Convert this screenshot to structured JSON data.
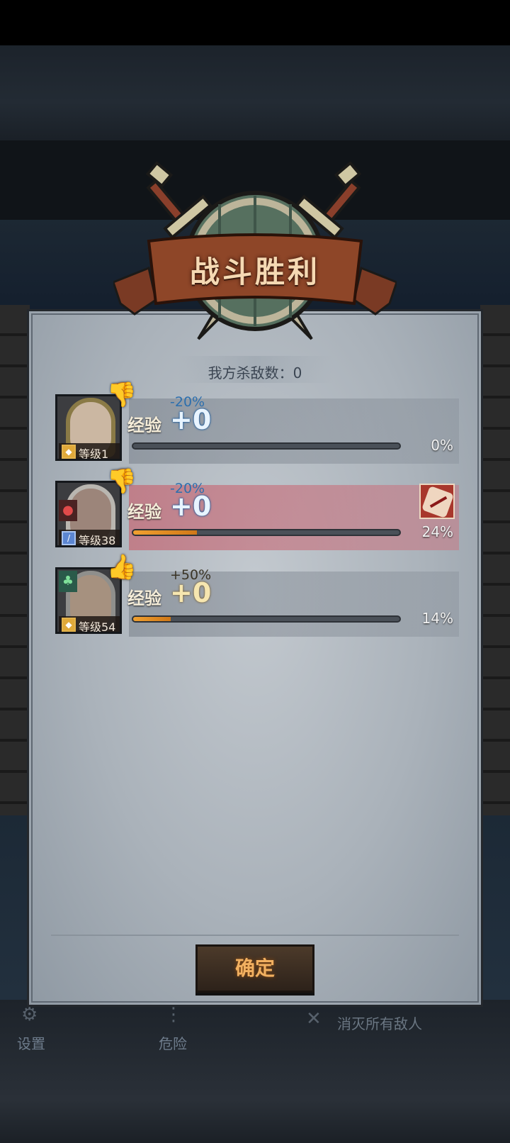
{
  "header": {
    "title": "战斗胜利",
    "kills_text": "我方杀敌数：0"
  },
  "heroes": [
    {
      "name_icon": "female-warrior-portrait",
      "level": "等级1",
      "badge_icon": "shield-icon",
      "class_icon": "",
      "morale_icon": "thumbs-down-icon",
      "modifier": "-20%",
      "exp_label": "经验",
      "exp_value": "+0",
      "progress": 0,
      "progress_text": "0%",
      "highlighted": false,
      "status_icon": ""
    },
    {
      "name_icon": "scarred-old-warrior-portrait",
      "level": "等级38",
      "badge_icon": "sword-icon",
      "class_icon": "blood-drop-icon",
      "morale_icon": "thumbs-down-icon",
      "modifier": "-20%",
      "exp_label": "经验",
      "exp_value": "+0",
      "progress": 0.24,
      "progress_text": "24%",
      "highlighted": true,
      "status_icon": "injury-icon"
    },
    {
      "name_icon": "bearded-veteran-portrait",
      "level": "等级54",
      "badge_icon": "shield-icon",
      "class_icon": "tree-icon",
      "morale_icon": "thumbs-up-icon",
      "modifier": "+50%",
      "exp_label": "经验",
      "exp_value": "+0",
      "progress": 0.14,
      "progress_text": "14%",
      "highlighted": false,
      "status_icon": ""
    }
  ],
  "confirm_label": "确定",
  "toolbar": {
    "settings_label": "设置",
    "danger_label": "危险",
    "objective_label": "消灭所有敌人"
  },
  "colors": {
    "title": "#f5d9b3",
    "exp_blue": "#e8f4ff",
    "highlight_row": "#c46c78",
    "progress_fill": "#f0a030",
    "confirm_text": "#f2b060"
  }
}
